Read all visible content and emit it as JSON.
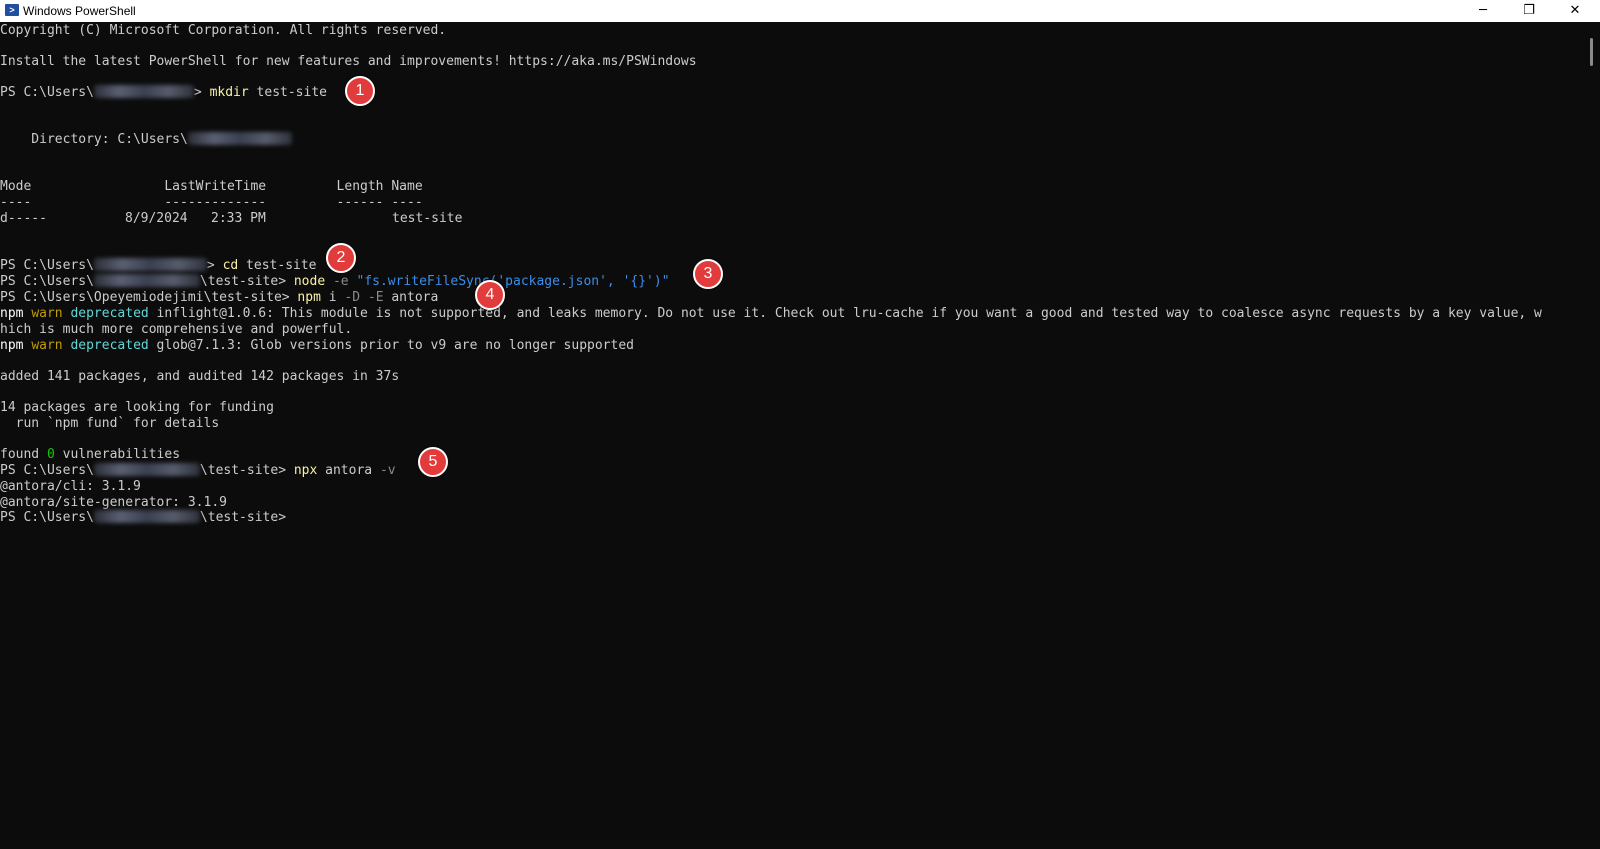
{
  "window": {
    "title": "Windows PowerShell",
    "minimize_glyph": "─",
    "maximize_glyph": "❐",
    "close_glyph": "✕"
  },
  "console": {
    "copyright": "Copyright (C) Microsoft Corporation. All rights reserved.",
    "install_hint": "Install the latest PowerShell for new features and improvements! https://aka.ms/PSWindows",
    "prompt_prefix": "PS C:\\Users\\",
    "prompt_suffix": ">",
    "prompt_suffix_site": "\\test-site>",
    "partial_user": "Opeyemiodejimi",
    "cmd1": {
      "name": "mkdir",
      "args": " test-site"
    },
    "directory_label": "    Directory: C:\\Users\\",
    "table_header": "Mode                 LastWriteTime         Length Name",
    "table_rule": "----                 -------------         ------ ----",
    "table_row": {
      "mode": "d-----",
      "date": "8/9/2024",
      "time": "2:33 PM",
      "name": "test-site"
    },
    "cmd2": {
      "name": "cd",
      "args": " test-site"
    },
    "cmd3": {
      "name": "node",
      "flag": " -e",
      "args": " \"fs.writeFileSync('package.json', '{}')\""
    },
    "cmd4": {
      "name": "npm",
      "args": " i",
      "flags": " -D -E",
      "pkg": " antora"
    },
    "warn1": {
      "npm": "npm",
      "warn": "warn",
      "deprecated": "deprecated",
      "text": " inflight@1.0.6: This module is not supported, and leaks memory. Do not use it. Check out lru-cache if you want a good and tested way to coalesce async requests by a key value, w",
      "cont": "hich is much more comprehensive and powerful."
    },
    "warn2": {
      "npm": "npm",
      "warn": "warn",
      "deprecated": "deprecated",
      "text": " glob@7.1.3: Glob versions prior to v9 are no longer supported"
    },
    "added": "added 141 packages, and audited 142 packages in 37s",
    "funding1": "14 packages are looking for funding",
    "funding2": "  run `npm fund` for details",
    "found_pre": "found ",
    "found_num": "0",
    "found_post": " vulnerabilities",
    "cmd5": {
      "name": "npx",
      "args": " antora",
      "flag": " -v"
    },
    "ver_cli": "@antora/cli: 3.1.9",
    "ver_gen": "@antora/site-generator: 3.1.9"
  },
  "markers": [
    "1",
    "2",
    "3",
    "4",
    "5"
  ],
  "colors": {
    "background": "#0c0c0c",
    "text": "#cccccc",
    "command": "#f9f1a5",
    "string_arg": "#3b8eea",
    "flag": "#8a8a8a",
    "warn": "#c19c00",
    "success": "#16c60c",
    "marker": "#e23b3b"
  }
}
